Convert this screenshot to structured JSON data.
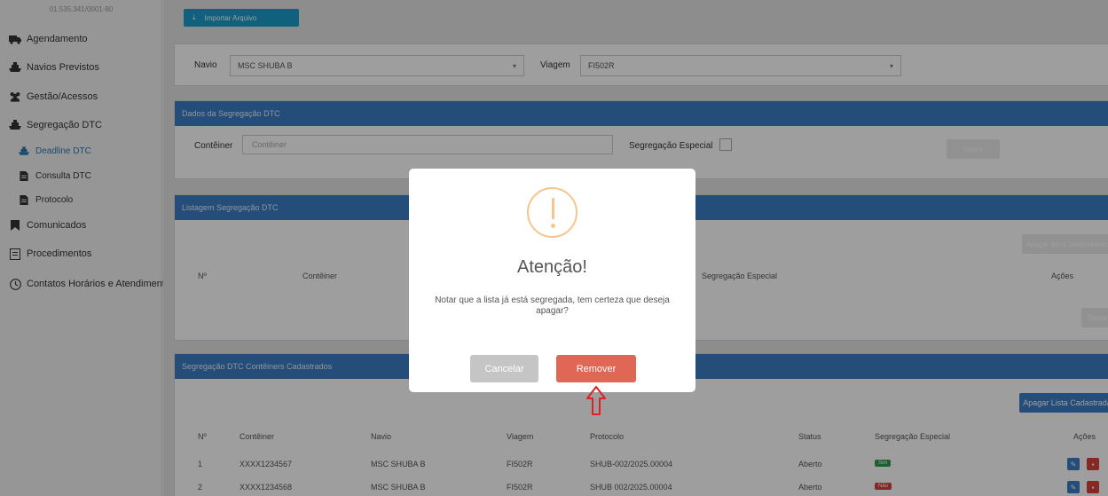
{
  "sidebar": {
    "cnpj": "01.535.341/0001-80",
    "items": [
      {
        "label": "Agendamento",
        "icon": "truck-icon"
      },
      {
        "label": "Navios Previstos",
        "icon": "ship-icon"
      },
      {
        "label": "Gestão/Acessos",
        "icon": "users-icon"
      },
      {
        "label": "Segregação DTC",
        "icon": "ship-icon"
      },
      {
        "label": "Deadline DTC",
        "icon": "ship-icon"
      },
      {
        "label": "Consulta DTC",
        "icon": "doc-icon"
      },
      {
        "label": "Protocolo",
        "icon": "doc-icon"
      },
      {
        "label": "Comunicados",
        "icon": "bookmark-icon"
      },
      {
        "label": "Procedimentos",
        "icon": "file-icon"
      },
      {
        "label": "Contatos Horários e Atendimento",
        "icon": "clock-icon"
      }
    ]
  },
  "top": {
    "import_label": "Importar Arquivo"
  },
  "filters": {
    "navio_label": "Navio",
    "navio_value": "MSC SHUBA B",
    "viagem_label": "Viagem",
    "viagem_value": "FI502R"
  },
  "dados": {
    "title": "Dados da Segregação DTC",
    "conteiner_label": "Contêiner",
    "conteiner_placeholder": "Contêiner",
    "especial_label": "Segregação Especial",
    "submit_label": "Inserir"
  },
  "listagem": {
    "title": "Listagem Segregação DTC",
    "top_button": "Apagar Itens Selecionados",
    "headers": [
      "Nº",
      "Contêiner",
      "Segregação Especial",
      "Ações"
    ],
    "bottom_button": "Salvar"
  },
  "cadastrados": {
    "title": "Segregação DTC Contêiners Cadastrados",
    "clear_button": "Apagar Lista Cadastrada",
    "headers": [
      "Nº",
      "Contêiner",
      "Navio",
      "Viagem",
      "Protocolo",
      "Status",
      "Segregação Especial",
      "Ações"
    ],
    "rows": [
      {
        "n": "1",
        "conteiner": "XXXX1234567",
        "navio": "MSC SHUBA B",
        "viagem": "FI502R",
        "protocolo": "SHUB-002/2025.00004",
        "status": "Aberto",
        "especial": "Sim"
      },
      {
        "n": "2",
        "conteiner": "XXXX1234568",
        "navio": "MSC SHUBA B",
        "viagem": "FI502R",
        "protocolo": "SHUB 002/2025.00004",
        "status": "Aberto",
        "especial": "Não"
      }
    ]
  },
  "modal": {
    "title": "Atenção!",
    "message": "Notar que a lista já está segregada, tem certeza que deseja apagar?",
    "cancel_label": "Cancelar",
    "confirm_label": "Remover"
  },
  "colors": {
    "primary": "#3a7cc6",
    "danger": "#e06655",
    "warning": "#f6c48f",
    "annotation": "#e21e26"
  }
}
